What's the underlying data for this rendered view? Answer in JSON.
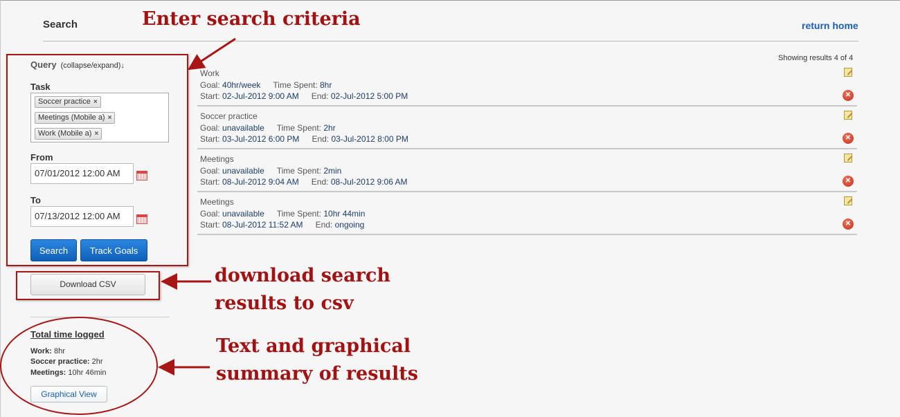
{
  "header": {
    "title": "Search",
    "return_home": "return home"
  },
  "query": {
    "label": "Query",
    "toggle": "(collapse/expand)↓",
    "task_label": "Task",
    "task_tags": [
      "Soccer practice",
      "Meetings (Mobile a)",
      "Work (Mobile a)"
    ],
    "tag_remove_glyph": "×",
    "from_label": "From",
    "from_value": "07/01/2012 12:00 AM",
    "to_label": "To",
    "to_value": "07/13/2012 12:00 AM",
    "search_button": "Search",
    "track_goals_button": "Track Goals"
  },
  "download_csv_button": "Download CSV",
  "summary": {
    "title": "Total time logged",
    "lines": [
      {
        "key": "Work:",
        "value": " 8hr"
      },
      {
        "key": "Soccer practice:",
        "value": " 2hr"
      },
      {
        "key": "Meetings:",
        "value": " 10hr 46min"
      }
    ],
    "graphical_view_button": "Graphical View"
  },
  "annotations": {
    "search_criteria": "Enter search criteria",
    "download_line1": "download search",
    "download_line2": "results to csv",
    "summary_line1": "Text and graphical",
    "summary_line2": "summary of results"
  },
  "results": {
    "showing": "Showing results 4 of 4",
    "goal_label": "Goal:",
    "time_spent_label": "Time Spent:",
    "start_label": "Start:",
    "end_label": "End:",
    "items": [
      {
        "name": "Work",
        "goal": "40hr/week",
        "time_spent": "8hr",
        "start": "02-Jul-2012 9:00 AM",
        "end": "02-Jul-2012 5:00 PM"
      },
      {
        "name": "Soccer practice",
        "goal": "unavailable",
        "time_spent": "2hr",
        "start": "03-Jul-2012 6:00 PM",
        "end": "03-Jul-2012 8:00 PM"
      },
      {
        "name": "Meetings",
        "goal": "unavailable",
        "time_spent": "2min",
        "start": "08-Jul-2012 9:04 AM",
        "end": "08-Jul-2012 9:06 AM"
      },
      {
        "name": "Meetings",
        "goal": "unavailable",
        "time_spent": "10hr 44min",
        "start": "08-Jul-2012 11:52 AM",
        "end": "ongoing"
      }
    ]
  },
  "colors": {
    "annotation": "#a31212",
    "accent_blue": "#1a5fb4"
  }
}
